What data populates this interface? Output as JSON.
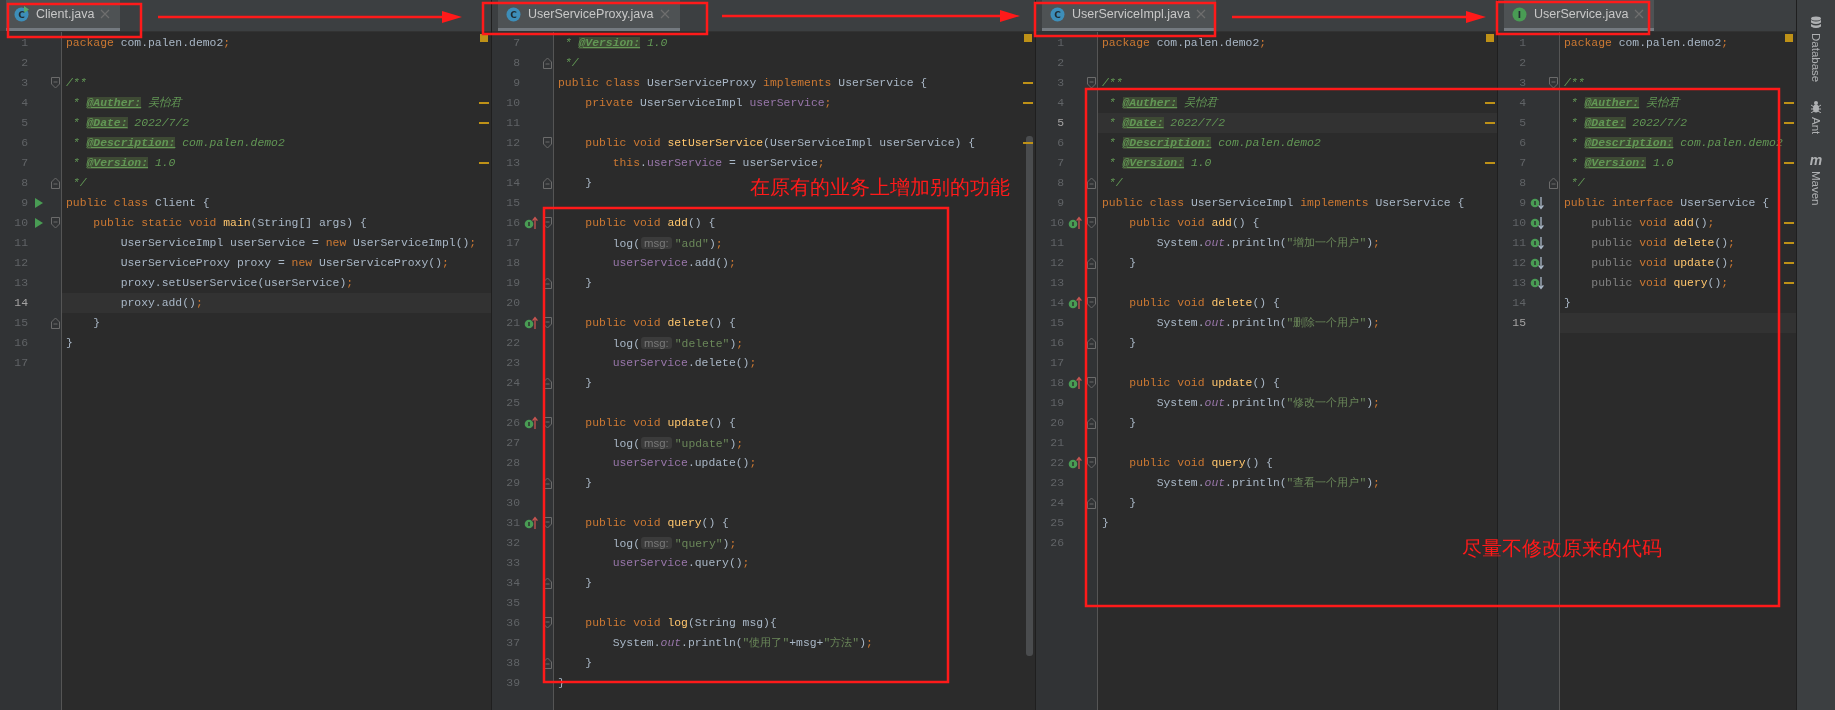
{
  "panes": [
    {
      "tab": {
        "label": "Client.java",
        "kind": "class_run",
        "icon_letter": "C"
      },
      "has_warnings": true,
      "lines": [
        {
          "num": "1",
          "tokens": [
            {
              "kind": "kw",
              "text": "package "
            },
            {
              "kind": "plain",
              "text": "com.palen.demo2"
            },
            {
              "kind": "kw",
              "text": ";"
            }
          ]
        },
        {
          "num": "2"
        },
        {
          "num": "3",
          "fold_start": true,
          "tokens": [
            {
              "kind": "doc",
              "text": "/**"
            }
          ]
        },
        {
          "num": "4",
          "warning": true,
          "tokens": [
            {
              "kind": "doc",
              "text": " * "
            },
            {
              "kind": "tag",
              "text": "@Auther:"
            },
            {
              "kind": "doc",
              "text": " 吴怡君"
            }
          ]
        },
        {
          "num": "5",
          "warning": true,
          "tokens": [
            {
              "kind": "doc",
              "text": " * "
            },
            {
              "kind": "tag",
              "text": "@Date:"
            },
            {
              "kind": "doc",
              "text": " 2022/7/2"
            }
          ]
        },
        {
          "num": "6",
          "tokens": [
            {
              "kind": "doc",
              "text": " * "
            },
            {
              "kind": "tag",
              "text": "@Description:"
            },
            {
              "kind": "doc",
              "text": " com.palen.demo2"
            }
          ]
        },
        {
          "num": "7",
          "warning": true,
          "tokens": [
            {
              "kind": "doc",
              "text": " * "
            },
            {
              "kind": "tag",
              "text": "@Version:"
            },
            {
              "kind": "doc",
              "text": " 1.0"
            }
          ]
        },
        {
          "num": "8",
          "fold_end": true,
          "tokens": [
            {
              "kind": "doc",
              "text": " */"
            }
          ]
        },
        {
          "num": "9",
          "marker": {
            "kind": "run"
          },
          "tokens": [
            {
              "kind": "kw",
              "text": "public class "
            },
            {
              "kind": "plain",
              "text": "Client {"
            }
          ]
        },
        {
          "num": "10",
          "marker": {
            "kind": "run"
          },
          "fold_start": true,
          "tokens": [
            {
              "kind": "kw",
              "text": "    public static void "
            },
            {
              "kind": "method",
              "text": "main"
            },
            {
              "kind": "plain",
              "text": "(String[] args) {"
            }
          ]
        },
        {
          "num": "11",
          "tokens": [
            {
              "kind": "plain",
              "text": "        UserServiceImpl userService = "
            },
            {
              "kind": "kw",
              "text": "new "
            },
            {
              "kind": "plain",
              "text": "UserServiceImpl()"
            },
            {
              "kind": "kw",
              "text": ";"
            }
          ]
        },
        {
          "num": "12",
          "tokens": [
            {
              "kind": "plain",
              "text": "        UserServiceProxy proxy = "
            },
            {
              "kind": "kw",
              "text": "new "
            },
            {
              "kind": "plain",
              "text": "UserServiceProxy()"
            },
            {
              "kind": "kw",
              "text": ";"
            }
          ]
        },
        {
          "num": "13",
          "tokens": [
            {
              "kind": "plain",
              "text": "        proxy.setUserService(userService)"
            },
            {
              "kind": "kw",
              "text": ";"
            }
          ]
        },
        {
          "num": "14",
          "current": true,
          "tokens": [
            {
              "kind": "plain",
              "text": "        proxy.add()"
            },
            {
              "kind": "kw",
              "text": ";"
            }
          ]
        },
        {
          "num": "15",
          "fold_end": true,
          "tokens": [
            {
              "kind": "plain",
              "text": "    }"
            }
          ]
        },
        {
          "num": "16",
          "tokens": [
            {
              "kind": "plain",
              "text": "}"
            }
          ]
        },
        {
          "num": "17"
        }
      ]
    },
    {
      "tab": {
        "label": "UserServiceProxy.java",
        "kind": "class",
        "icon_letter": "C"
      },
      "has_warnings": true,
      "scrollbar": true,
      "lines": [
        {
          "num": "7",
          "tokens": [
            {
              "kind": "doc",
              "text": " * "
            },
            {
              "kind": "tag",
              "text": "@Version:"
            },
            {
              "kind": "doc",
              "text": " 1.0"
            }
          ]
        },
        {
          "num": "8",
          "fold_end": true,
          "tokens": [
            {
              "kind": "doc",
              "text": " */"
            }
          ]
        },
        {
          "num": "9",
          "warning": true,
          "tokens": [
            {
              "kind": "kw",
              "text": "public class "
            },
            {
              "kind": "plain",
              "text": "UserServiceProxy "
            },
            {
              "kind": "kw",
              "text": "implements "
            },
            {
              "kind": "plain",
              "text": "UserService {"
            }
          ]
        },
        {
          "num": "10",
          "warning": true,
          "tokens": [
            {
              "kind": "kw",
              "text": "    private "
            },
            {
              "kind": "plain",
              "text": "UserServiceImpl "
            },
            {
              "kind": "field",
              "text": "userService"
            },
            {
              "kind": "kw",
              "text": ";"
            }
          ]
        },
        {
          "num": "11"
        },
        {
          "num": "12",
          "warning": true,
          "fold_start": true,
          "tokens": [
            {
              "kind": "kw",
              "text": "    public void "
            },
            {
              "kind": "method",
              "text": "setUserService"
            },
            {
              "kind": "plain",
              "text": "(UserServiceImpl userService) {"
            }
          ]
        },
        {
          "num": "13",
          "tokens": [
            {
              "kind": "kw",
              "text": "        this"
            },
            {
              "kind": "plain",
              "text": "."
            },
            {
              "kind": "field",
              "text": "userService"
            },
            {
              "kind": "plain",
              "text": " = userService"
            },
            {
              "kind": "kw",
              "text": ";"
            }
          ]
        },
        {
          "num": "14",
          "fold_end": true,
          "tokens": [
            {
              "kind": "plain",
              "text": "    }"
            }
          ]
        },
        {
          "num": "15"
        },
        {
          "num": "16",
          "marker": {
            "kind": "implements"
          },
          "fold_start": true,
          "tokens": [
            {
              "kind": "kw",
              "text": "    public void "
            },
            {
              "kind": "method",
              "text": "add"
            },
            {
              "kind": "plain",
              "text": "() {"
            }
          ]
        },
        {
          "num": "17",
          "tokens": [
            {
              "kind": "plain",
              "text": "        log("
            },
            {
              "kind": "hint",
              "text": "msg:"
            },
            {
              "kind": "str",
              "text": "\"add\""
            },
            {
              "kind": "plain",
              "text": ")"
            },
            {
              "kind": "kw",
              "text": ";"
            }
          ]
        },
        {
          "num": "18",
          "tokens": [
            {
              "kind": "field",
              "text": "        userService"
            },
            {
              "kind": "plain",
              "text": ".add()"
            },
            {
              "kind": "kw",
              "text": ";"
            }
          ]
        },
        {
          "num": "19",
          "fold_end": true,
          "tokens": [
            {
              "kind": "plain",
              "text": "    }"
            }
          ]
        },
        {
          "num": "20"
        },
        {
          "num": "21",
          "marker": {
            "kind": "implements"
          },
          "fold_start": true,
          "tokens": [
            {
              "kind": "kw",
              "text": "    public void "
            },
            {
              "kind": "method",
              "text": "delete"
            },
            {
              "kind": "plain",
              "text": "() {"
            }
          ]
        },
        {
          "num": "22",
          "tokens": [
            {
              "kind": "plain",
              "text": "        log("
            },
            {
              "kind": "hint",
              "text": "msg:"
            },
            {
              "kind": "str",
              "text": "\"delete\""
            },
            {
              "kind": "plain",
              "text": ")"
            },
            {
              "kind": "kw",
              "text": ";"
            }
          ]
        },
        {
          "num": "23",
          "tokens": [
            {
              "kind": "field",
              "text": "        userService"
            },
            {
              "kind": "plain",
              "text": ".delete()"
            },
            {
              "kind": "kw",
              "text": ";"
            }
          ]
        },
        {
          "num": "24",
          "fold_end": true,
          "tokens": [
            {
              "kind": "plain",
              "text": "    }"
            }
          ]
        },
        {
          "num": "25"
        },
        {
          "num": "26",
          "marker": {
            "kind": "implements"
          },
          "fold_start": true,
          "tokens": [
            {
              "kind": "kw",
              "text": "    public void "
            },
            {
              "kind": "method",
              "text": "update"
            },
            {
              "kind": "plain",
              "text": "() {"
            }
          ]
        },
        {
          "num": "27",
          "tokens": [
            {
              "kind": "plain",
              "text": "        log("
            },
            {
              "kind": "hint",
              "text": "msg:"
            },
            {
              "kind": "str",
              "text": "\"update\""
            },
            {
              "kind": "plain",
              "text": ")"
            },
            {
              "kind": "kw",
              "text": ";"
            }
          ]
        },
        {
          "num": "28",
          "tokens": [
            {
              "kind": "field",
              "text": "        userService"
            },
            {
              "kind": "plain",
              "text": ".update()"
            },
            {
              "kind": "kw",
              "text": ";"
            }
          ]
        },
        {
          "num": "29",
          "fold_end": true,
          "tokens": [
            {
              "kind": "plain",
              "text": "    }"
            }
          ]
        },
        {
          "num": "30"
        },
        {
          "num": "31",
          "marker": {
            "kind": "implements"
          },
          "fold_start": true,
          "tokens": [
            {
              "kind": "kw",
              "text": "    public void "
            },
            {
              "kind": "method",
              "text": "query"
            },
            {
              "kind": "plain",
              "text": "() {"
            }
          ]
        },
        {
          "num": "32",
          "tokens": [
            {
              "kind": "plain",
              "text": "        log("
            },
            {
              "kind": "hint",
              "text": "msg:"
            },
            {
              "kind": "str",
              "text": "\"query\""
            },
            {
              "kind": "plain",
              "text": ")"
            },
            {
              "kind": "kw",
              "text": ";"
            }
          ]
        },
        {
          "num": "33",
          "tokens": [
            {
              "kind": "field",
              "text": "        userService"
            },
            {
              "kind": "plain",
              "text": ".query()"
            },
            {
              "kind": "kw",
              "text": ";"
            }
          ]
        },
        {
          "num": "34",
          "fold_end": true,
          "tokens": [
            {
              "kind": "plain",
              "text": "    }"
            }
          ]
        },
        {
          "num": "35"
        },
        {
          "num": "36",
          "fold_start": true,
          "tokens": [
            {
              "kind": "kw",
              "text": "    public void "
            },
            {
              "kind": "method",
              "text": "log"
            },
            {
              "kind": "plain",
              "text": "(String msg){"
            }
          ]
        },
        {
          "num": "37",
          "tokens": [
            {
              "kind": "plain",
              "text": "        System."
            },
            {
              "kind": "static",
              "text": "out"
            },
            {
              "kind": "plain",
              "text": ".println("
            },
            {
              "kind": "str",
              "text": "\"使用了\""
            },
            {
              "kind": "plain",
              "text": "+msg+"
            },
            {
              "kind": "str",
              "text": "\"方法\""
            },
            {
              "kind": "plain",
              "text": ")"
            },
            {
              "kind": "kw",
              "text": ";"
            }
          ]
        },
        {
          "num": "38",
          "fold_end": true,
          "tokens": [
            {
              "kind": "plain",
              "text": "    }"
            }
          ]
        },
        {
          "num": "39",
          "tokens": [
            {
              "kind": "plain",
              "text": "}"
            }
          ]
        }
      ]
    },
    {
      "tab": {
        "label": "UserServiceImpl.java",
        "kind": "class",
        "icon_letter": "C"
      },
      "has_warnings": true,
      "lines": [
        {
          "num": "1",
          "tokens": [
            {
              "kind": "kw",
              "text": "package "
            },
            {
              "kind": "plain",
              "text": "com.palen.demo2"
            },
            {
              "kind": "kw",
              "text": ";"
            }
          ]
        },
        {
          "num": "2"
        },
        {
          "num": "3",
          "fold_start": true,
          "tokens": [
            {
              "kind": "doc",
              "text": "/**"
            }
          ]
        },
        {
          "num": "4",
          "warning": true,
          "tokens": [
            {
              "kind": "doc",
              "text": " * "
            },
            {
              "kind": "tag",
              "text": "@Auther:"
            },
            {
              "kind": "doc",
              "text": " 吴怡君"
            }
          ]
        },
        {
          "num": "5",
          "warning": true,
          "current": true,
          "tokens": [
            {
              "kind": "doc",
              "text": " * "
            },
            {
              "kind": "tag",
              "text": "@Date:"
            },
            {
              "kind": "doc",
              "text": " 2022/7/2"
            }
          ]
        },
        {
          "num": "6",
          "tokens": [
            {
              "kind": "doc",
              "text": " * "
            },
            {
              "kind": "tag",
              "text": "@Description:"
            },
            {
              "kind": "doc",
              "text": " com.palen.demo2"
            }
          ]
        },
        {
          "num": "7",
          "warning": true,
          "tokens": [
            {
              "kind": "doc",
              "text": " * "
            },
            {
              "kind": "tag",
              "text": "@Version:"
            },
            {
              "kind": "doc",
              "text": " 1.0"
            }
          ]
        },
        {
          "num": "8",
          "fold_end": true,
          "tokens": [
            {
              "kind": "doc",
              "text": " */"
            }
          ]
        },
        {
          "num": "9",
          "tokens": [
            {
              "kind": "kw",
              "text": "public class "
            },
            {
              "kind": "plain",
              "text": "UserServiceImpl "
            },
            {
              "kind": "kw",
              "text": "implements "
            },
            {
              "kind": "plain",
              "text": "UserService {"
            }
          ]
        },
        {
          "num": "10",
          "marker": {
            "kind": "implements"
          },
          "fold_start": true,
          "tokens": [
            {
              "kind": "kw",
              "text": "    public void "
            },
            {
              "kind": "method",
              "text": "add"
            },
            {
              "kind": "plain",
              "text": "() {"
            }
          ]
        },
        {
          "num": "11",
          "tokens": [
            {
              "kind": "plain",
              "text": "        System."
            },
            {
              "kind": "static",
              "text": "out"
            },
            {
              "kind": "plain",
              "text": ".println("
            },
            {
              "kind": "str",
              "text": "\"增加一个用户\""
            },
            {
              "kind": "plain",
              "text": ")"
            },
            {
              "kind": "kw",
              "text": ";"
            }
          ]
        },
        {
          "num": "12",
          "fold_end": true,
          "tokens": [
            {
              "kind": "plain",
              "text": "    }"
            }
          ]
        },
        {
          "num": "13"
        },
        {
          "num": "14",
          "marker": {
            "kind": "implements"
          },
          "fold_start": true,
          "tokens": [
            {
              "kind": "kw",
              "text": "    public void "
            },
            {
              "kind": "method",
              "text": "delete"
            },
            {
              "kind": "plain",
              "text": "() {"
            }
          ]
        },
        {
          "num": "15",
          "tokens": [
            {
              "kind": "plain",
              "text": "        System."
            },
            {
              "kind": "static",
              "text": "out"
            },
            {
              "kind": "plain",
              "text": ".println("
            },
            {
              "kind": "str",
              "text": "\"删除一个用户\""
            },
            {
              "kind": "plain",
              "text": ")"
            },
            {
              "kind": "kw",
              "text": ";"
            }
          ]
        },
        {
          "num": "16",
          "fold_end": true,
          "tokens": [
            {
              "kind": "plain",
              "text": "    }"
            }
          ]
        },
        {
          "num": "17"
        },
        {
          "num": "18",
          "marker": {
            "kind": "implements"
          },
          "fold_start": true,
          "tokens": [
            {
              "kind": "kw",
              "text": "    public void "
            },
            {
              "kind": "method",
              "text": "update"
            },
            {
              "kind": "plain",
              "text": "() {"
            }
          ]
        },
        {
          "num": "19",
          "tokens": [
            {
              "kind": "plain",
              "text": "        System."
            },
            {
              "kind": "static",
              "text": "out"
            },
            {
              "kind": "plain",
              "text": ".println("
            },
            {
              "kind": "str",
              "text": "\"修改一个用户\""
            },
            {
              "kind": "plain",
              "text": ")"
            },
            {
              "kind": "kw",
              "text": ";"
            }
          ]
        },
        {
          "num": "20",
          "fold_end": true,
          "tokens": [
            {
              "kind": "plain",
              "text": "    }"
            }
          ]
        },
        {
          "num": "21"
        },
        {
          "num": "22",
          "marker": {
            "kind": "implements"
          },
          "fold_start": true,
          "tokens": [
            {
              "kind": "kw",
              "text": "    public void "
            },
            {
              "kind": "method",
              "text": "query"
            },
            {
              "kind": "plain",
              "text": "() {"
            }
          ]
        },
        {
          "num": "23",
          "tokens": [
            {
              "kind": "plain",
              "text": "        System."
            },
            {
              "kind": "static",
              "text": "out"
            },
            {
              "kind": "plain",
              "text": ".println("
            },
            {
              "kind": "str",
              "text": "\"查看一个用户\""
            },
            {
              "kind": "plain",
              "text": ")"
            },
            {
              "kind": "kw",
              "text": ";"
            }
          ]
        },
        {
          "num": "24",
          "fold_end": true,
          "tokens": [
            {
              "kind": "plain",
              "text": "    }"
            }
          ]
        },
        {
          "num": "25",
          "tokens": [
            {
              "kind": "plain",
              "text": "}"
            }
          ]
        },
        {
          "num": "26"
        }
      ]
    },
    {
      "tab": {
        "label": "UserService.java",
        "kind": "interface",
        "icon_letter": "I"
      },
      "has_warnings": true,
      "lines": [
        {
          "num": "1",
          "tokens": [
            {
              "kind": "kw",
              "text": "package "
            },
            {
              "kind": "plain",
              "text": "com.palen.demo2"
            },
            {
              "kind": "kw",
              "text": ";"
            }
          ]
        },
        {
          "num": "2"
        },
        {
          "num": "3",
          "fold_start": true,
          "tokens": [
            {
              "kind": "doc",
              "text": "/**"
            }
          ]
        },
        {
          "num": "4",
          "warning": true,
          "tokens": [
            {
              "kind": "doc",
              "text": " * "
            },
            {
              "kind": "tag",
              "text": "@Auther:"
            },
            {
              "kind": "doc",
              "text": " 吴怡君"
            }
          ]
        },
        {
          "num": "5",
          "warning": true,
          "tokens": [
            {
              "kind": "doc",
              "text": " * "
            },
            {
              "kind": "tag",
              "text": "@Date:"
            },
            {
              "kind": "doc",
              "text": " 2022/7/2"
            }
          ]
        },
        {
          "num": "6",
          "tokens": [
            {
              "kind": "doc",
              "text": " * "
            },
            {
              "kind": "tag",
              "text": "@Description:"
            },
            {
              "kind": "doc",
              "text": " com.palen.demo2"
            }
          ]
        },
        {
          "num": "7",
          "warning": true,
          "tokens": [
            {
              "kind": "doc",
              "text": " * "
            },
            {
              "kind": "tag",
              "text": "@Version:"
            },
            {
              "kind": "doc",
              "text": " 1.0"
            }
          ]
        },
        {
          "num": "8",
          "fold_end": true,
          "tokens": [
            {
              "kind": "doc",
              "text": " */"
            }
          ]
        },
        {
          "num": "9",
          "marker": {
            "kind": "implemented"
          },
          "tokens": [
            {
              "kind": "kw",
              "text": "public interface "
            },
            {
              "kind": "plain",
              "text": "UserService {"
            }
          ]
        },
        {
          "num": "10",
          "marker": {
            "kind": "implemented"
          },
          "warning": true,
          "tokens": [
            {
              "kind": "grey",
              "text": "    public "
            },
            {
              "kind": "kw",
              "text": "void "
            },
            {
              "kind": "method",
              "text": "add"
            },
            {
              "kind": "plain",
              "text": "()"
            },
            {
              "kind": "kw",
              "text": ";"
            }
          ]
        },
        {
          "num": "11",
          "marker": {
            "kind": "implemented"
          },
          "warning": true,
          "tokens": [
            {
              "kind": "grey",
              "text": "    public "
            },
            {
              "kind": "kw",
              "text": "void "
            },
            {
              "kind": "method",
              "text": "delete"
            },
            {
              "kind": "plain",
              "text": "()"
            },
            {
              "kind": "kw",
              "text": ";"
            }
          ]
        },
        {
          "num": "12",
          "marker": {
            "kind": "implemented"
          },
          "warning": true,
          "tokens": [
            {
              "kind": "grey",
              "text": "    public "
            },
            {
              "kind": "kw",
              "text": "void "
            },
            {
              "kind": "method",
              "text": "update"
            },
            {
              "kind": "plain",
              "text": "()"
            },
            {
              "kind": "kw",
              "text": ";"
            }
          ]
        },
        {
          "num": "13",
          "marker": {
            "kind": "implemented"
          },
          "warning": true,
          "tokens": [
            {
              "kind": "grey",
              "text": "    public "
            },
            {
              "kind": "kw",
              "text": "void "
            },
            {
              "kind": "method",
              "text": "query"
            },
            {
              "kind": "plain",
              "text": "()"
            },
            {
              "kind": "kw",
              "text": ";"
            }
          ]
        },
        {
          "num": "14",
          "tokens": [
            {
              "kind": "plain",
              "text": "}"
            }
          ]
        },
        {
          "num": "15",
          "current": true
        }
      ]
    }
  ],
  "tool_windows": [
    {
      "label": "Database",
      "kind": "database"
    },
    {
      "label": "Ant",
      "kind": "ant"
    },
    {
      "label": "Maven",
      "kind": "maven",
      "icon_glyph": "m"
    }
  ],
  "annotations": [
    {
      "text": "在原有的业务上增加别的功能"
    },
    {
      "text": "尽量不修改原来的代码"
    }
  ]
}
